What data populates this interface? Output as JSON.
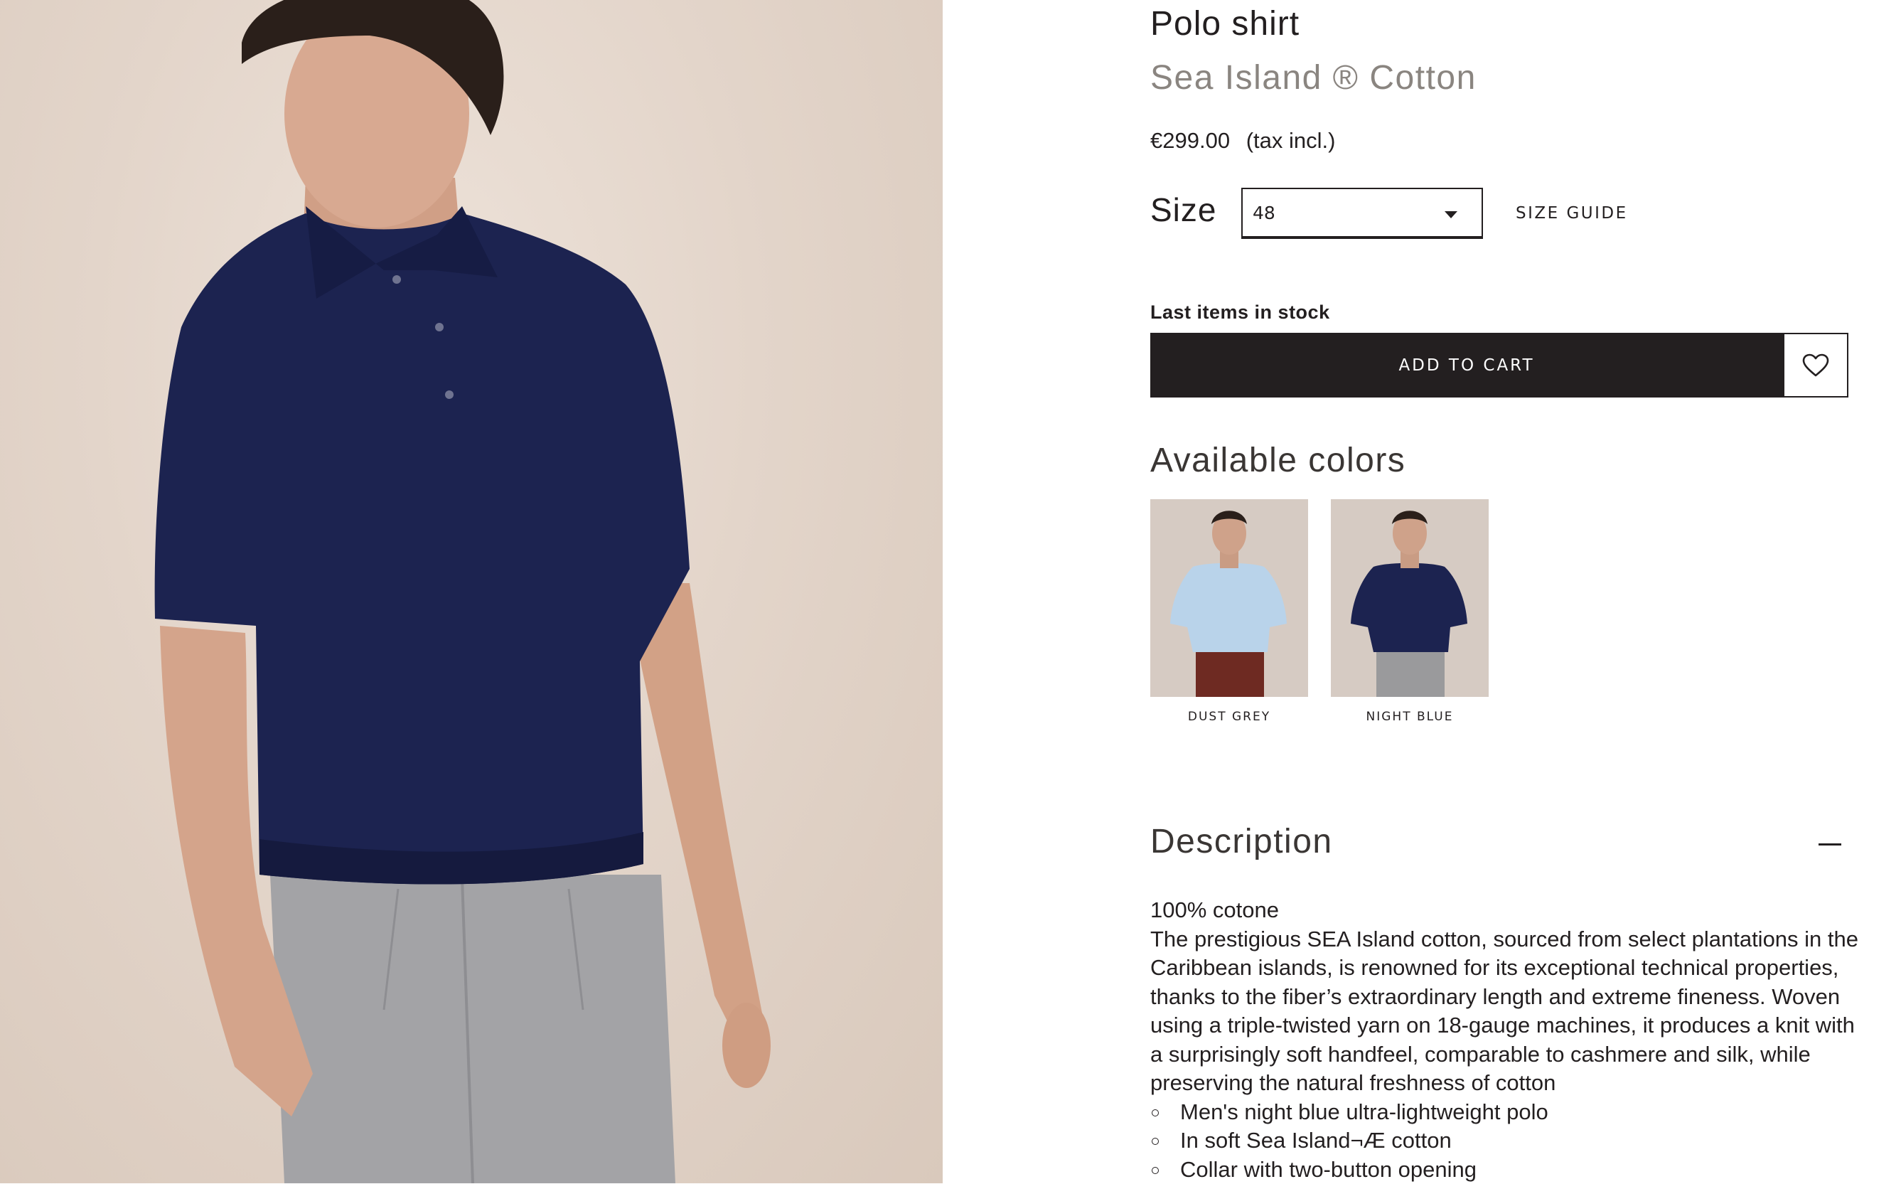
{
  "product": {
    "title": "Polo shirt",
    "subtitle": "Sea Island ® Cotton",
    "price": "€299.00",
    "tax_note": "(tax incl.)"
  },
  "size": {
    "label": "Size",
    "selected": "48",
    "guide_label": "SIZE GUIDE"
  },
  "stock_status": "Last items in stock",
  "cart": {
    "add_label": "ADD TO CART",
    "wishlist_icon": "heart-icon"
  },
  "colors": {
    "heading": "Available colors",
    "items": [
      {
        "name": "DUST GREY",
        "shirt_color": "#b9d3ea",
        "pants_color": "#6e2a22"
      },
      {
        "name": "NIGHT BLUE",
        "shirt_color": "#1c2350",
        "pants_color": "#9a9a9c"
      }
    ]
  },
  "description": {
    "heading": "Description",
    "composition": "100% cotone",
    "text": "The prestigious SEA Island cotton, sourced from select plantations in the Caribbean islands, is renowned for its exceptional technical properties, thanks to the fiber’s extraordinary length and extreme fineness. Woven using a triple-twisted yarn on 18-gauge machines, it produces a knit with a surprisingly soft handfeel, comparable to cashmere and silk, while preserving the natural freshness of cotton",
    "bullets": [
      "Men's night blue ultra-lightweight polo",
      "In soft Sea Island¬Æ cotton",
      "Collar with two-button opening"
    ],
    "collapse_icon": "minus-icon"
  },
  "theme": {
    "text": "#231f20",
    "muted": "#8a8580",
    "button_bg": "#231f20",
    "backdrop": "#e6d9cf",
    "shirt": "#1c2350"
  }
}
